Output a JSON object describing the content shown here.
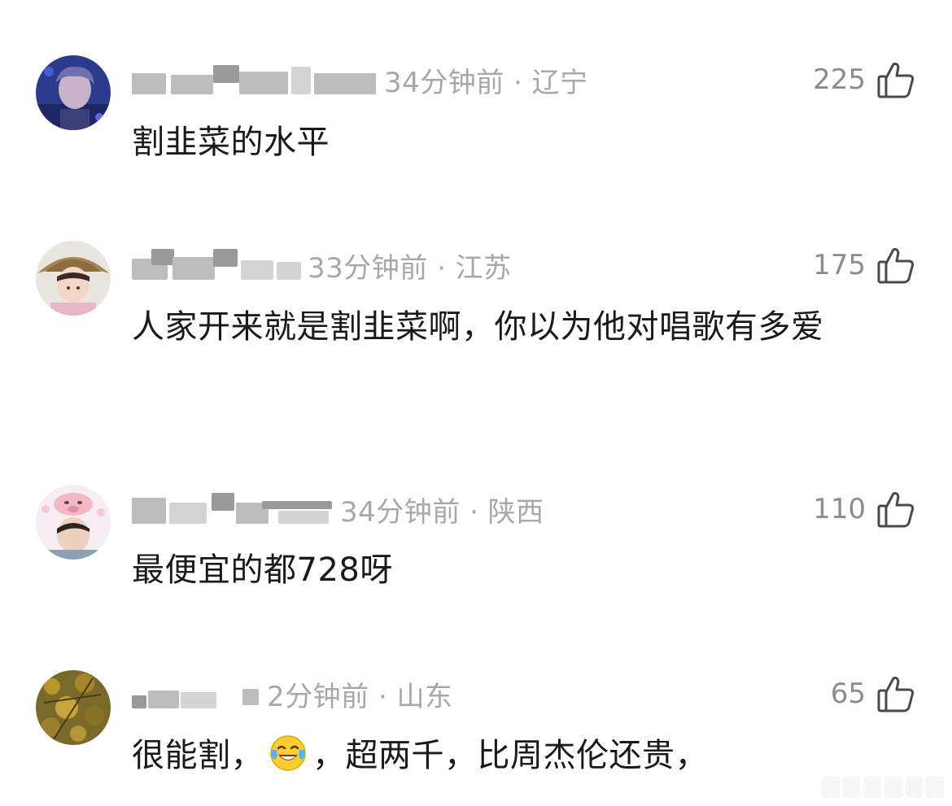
{
  "comments": [
    {
      "time_location": "34分钟前 · 辽宁",
      "likes": "225",
      "text": "割韭菜的水平"
    },
    {
      "time_location": "33分钟前 · 江苏",
      "likes": "175",
      "text": "人家开来就是割韭菜啊，你以为他对唱歌有多爱"
    },
    {
      "time_location": "34分钟前 · 陕西",
      "likes": "110",
      "text": "最便宜的都728呀"
    },
    {
      "time_location": "2分钟前 · 山东",
      "likes": "65",
      "text_before_emoji": "很能割，",
      "emoji": "tears-of-joy-emoji",
      "text_after_emoji": "，超两千，比周杰伦还贵，"
    }
  ],
  "icons": {
    "like": "thumbs-up-icon"
  },
  "colors": {
    "meta_text": "#a8a8a8",
    "like_count": "#8c8c8c",
    "content_text": "#1a1a1a",
    "background": "#ffffff"
  }
}
